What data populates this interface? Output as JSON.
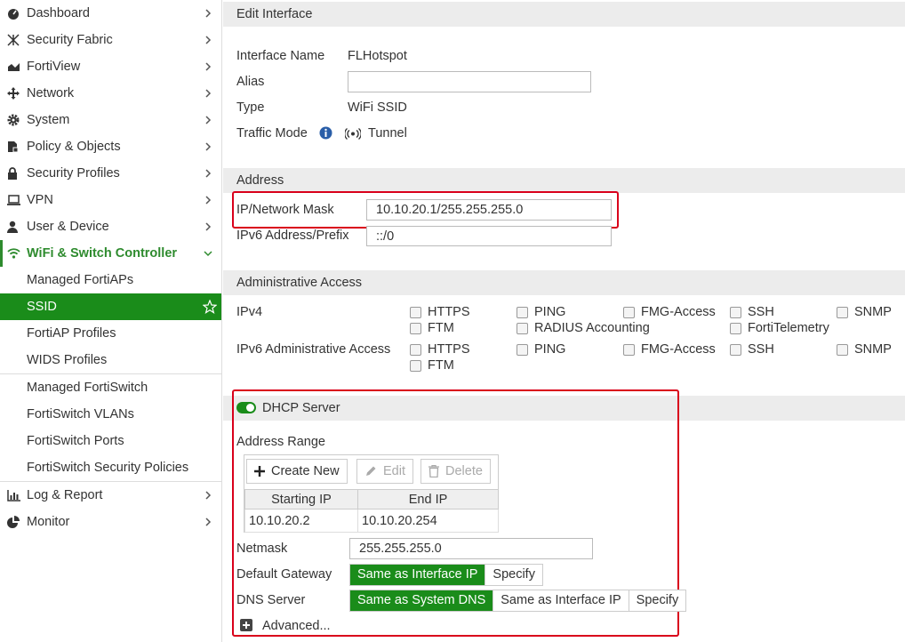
{
  "sidebar": {
    "items": [
      {
        "label": "Dashboard",
        "icon": "dashboard-icon"
      },
      {
        "label": "Security Fabric",
        "icon": "security-fabric-icon"
      },
      {
        "label": "FortiView",
        "icon": "fortiview-chart-icon"
      },
      {
        "label": "Network",
        "icon": "network-arrows-icon"
      },
      {
        "label": "System",
        "icon": "gear-icon"
      },
      {
        "label": "Policy & Objects",
        "icon": "policy-document-icon"
      },
      {
        "label": "Security Profiles",
        "icon": "lock-icon"
      },
      {
        "label": "VPN",
        "icon": "laptop-icon"
      },
      {
        "label": "User & Device",
        "icon": "user-icon"
      },
      {
        "label": "WiFi & Switch Controller",
        "icon": "wifi-icon"
      }
    ],
    "wifi_sub": [
      "Managed FortiAPs",
      "SSID",
      "FortiAP Profiles",
      "WIDS Profiles"
    ],
    "switch_sub": [
      "Managed FortiSwitch",
      "FortiSwitch VLANs",
      "FortiSwitch Ports",
      "FortiSwitch Security Policies"
    ],
    "bottom_items": [
      {
        "label": "Log & Report",
        "icon": "log-report-icon"
      },
      {
        "label": "Monitor",
        "icon": "monitor-pie-icon"
      }
    ]
  },
  "edit": {
    "header": "Edit Interface",
    "interface_name_label": "Interface Name",
    "interface_name_value": "FLHotspot",
    "alias_label": "Alias",
    "alias_value": "",
    "type_label": "Type",
    "type_value": "WiFi SSID",
    "traffic_mode_label": "Traffic Mode",
    "traffic_mode_value": "Tunnel"
  },
  "address": {
    "header": "Address",
    "ip_label": "IP/Network Mask",
    "ip_value": "10.10.20.1/255.255.255.0",
    "ipv6_label": "IPv6 Address/Prefix",
    "ipv6_value": "::/0"
  },
  "admin": {
    "header": "Administrative Access",
    "ipv4_label": "IPv4",
    "ipv4_options": [
      "HTTPS",
      "PING",
      "FMG-Access",
      "SSH",
      "SNMP",
      "FTM",
      "RADIUS Accounting",
      "FortiTelemetry"
    ],
    "ipv6_label": "IPv6 Administrative Access",
    "ipv6_options": [
      "HTTPS",
      "PING",
      "FMG-Access",
      "SSH",
      "SNMP",
      "FTM"
    ]
  },
  "dhcp": {
    "label": "DHCP Server",
    "address_range_label": "Address Range",
    "create_new": "Create New",
    "edit": "Edit",
    "delete": "Delete",
    "col_start": "Starting IP",
    "col_end": "End IP",
    "row_start": "10.10.20.2",
    "row_end": "10.10.20.254",
    "netmask_label": "Netmask",
    "netmask_value": "255.255.255.0",
    "gateway_label": "Default Gateway",
    "gateway_opts": [
      "Same as Interface IP",
      "Specify"
    ],
    "dns_label": "DNS Server",
    "dns_opts": [
      "Same as System DNS",
      "Same as Interface IP",
      "Specify"
    ],
    "advanced": "Advanced..."
  },
  "colors": {
    "accent": "#1a8c1a",
    "highlight": "#d9001b"
  }
}
